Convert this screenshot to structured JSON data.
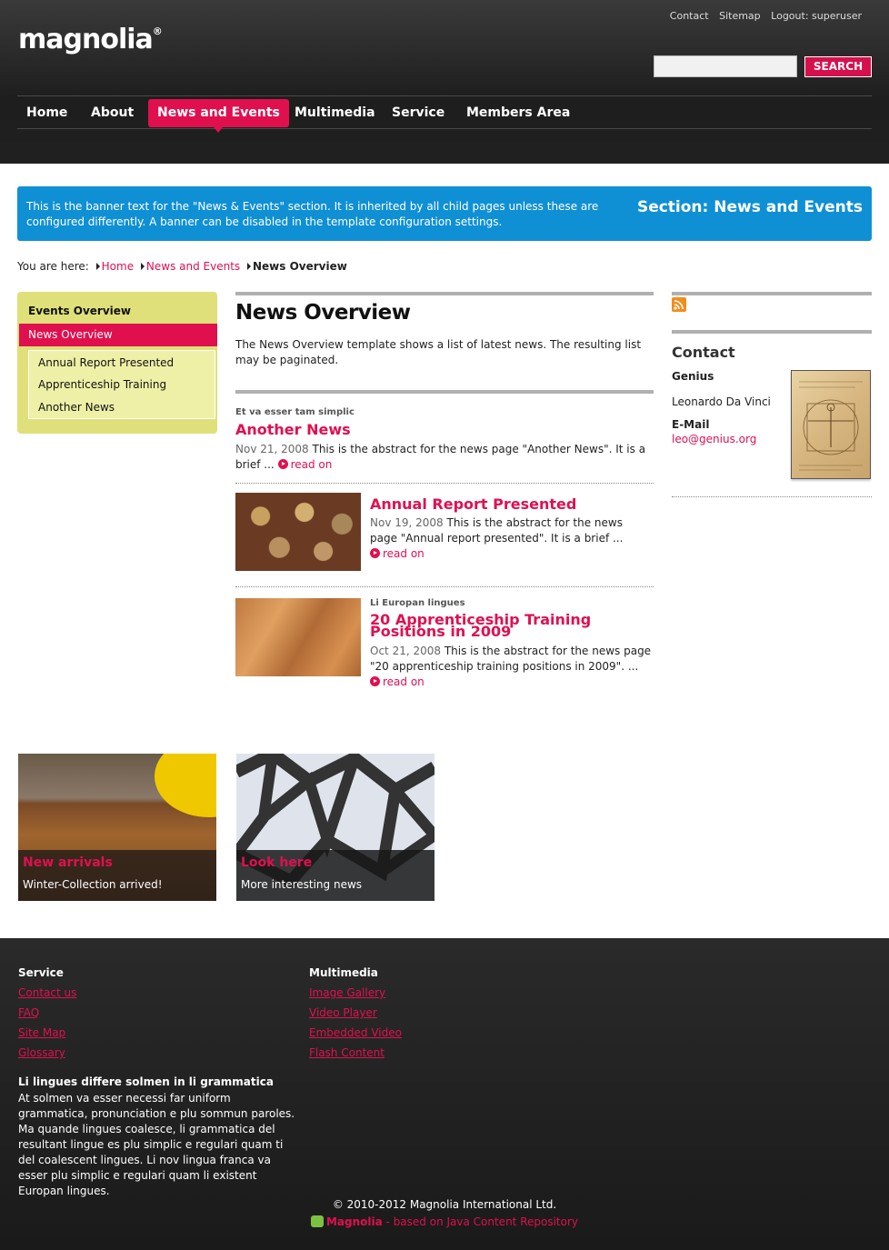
{
  "header": {
    "logo": "magnolia",
    "logo_mark": "®",
    "topnav": [
      "Contact",
      "Sitemap",
      "Logout: superuser"
    ],
    "search_placeholder": "",
    "search_label": "SEARCH",
    "nav": [
      "Home",
      "About",
      "News and Events",
      "Multimedia",
      "Service",
      "Members Area"
    ],
    "active_nav": "News and Events"
  },
  "banner": {
    "text": "This is the banner text for the \"News & Events\" section. It is inherited by all child pages unless these are configured differently. A banner can be disabled in the template configuration settings.",
    "title": "Section: News and Events",
    "color": "#1090d4"
  },
  "breadcrumb": {
    "label": "You are here:",
    "items": [
      "Home",
      "News and Events",
      "News Overview"
    ]
  },
  "subnav": {
    "parent": "Events Overview",
    "active": "News Overview",
    "children": [
      "Annual Report Presented",
      "Apprenticeship Training",
      "Another News"
    ]
  },
  "main": {
    "title": "News Overview",
    "intro": "The News Overview template shows a list of latest news. The resulting list may be paginated.",
    "news": [
      {
        "kicker": "Et va esser tam simplic",
        "title": "Another News",
        "date": "Nov 21, 2008",
        "abstract": "This is the abstract for the news page \"Another News\". It is a brief ...",
        "readon": "read on"
      },
      {
        "kicker": "",
        "title": "Annual Report Presented",
        "date": "Nov 19, 2008",
        "abstract": "This is the abstract for the news page \"Annual report presented\". It is a brief ...",
        "readon": "read on"
      },
      {
        "kicker": "Li Europan lingues",
        "title": "20 Apprenticeship Training Positions in 2009",
        "date": "Oct 21, 2008",
        "abstract": "This is the abstract for the news page \"20 apprenticeship training positions in 2009\". ...",
        "readon": "read on"
      }
    ]
  },
  "contact": {
    "title": "Contact",
    "name": "Genius",
    "person": "Leonardo  Da Vinci",
    "email_label": "E-Mail",
    "email": "leo@genius.org"
  },
  "teasers": [
    {
      "title": "New arrivals",
      "text": "Winter-Collection arrived!"
    },
    {
      "title": "Look here",
      "text": "More interesting news"
    }
  ],
  "footer": {
    "col1_title": "Service",
    "col1_links": [
      "Contact us",
      "FAQ",
      "Site Map",
      "Glossary"
    ],
    "col2_title": "Multimedia",
    "col2_links": [
      "Image Gallery",
      "Video Player",
      "Embedded Video",
      "Flash Content"
    ],
    "para_title": "Li lingues differe solmen in li grammatica",
    "para": "At solmen va esser necessi far uniform grammatica, pronunciation e plu sommun paroles. Ma quande lingues coalesce, li grammatica del resultant lingue es plu simplic e regulari quam ti del coalescent lingues. Li nov lingua franca va esser plu simplic e regulari quam li existent Europan lingues.",
    "copyright": "© 2010-2012 Magnolia International Ltd.",
    "powered_brand": "Magnolia",
    "powered_text": " - based on Java Content Repository"
  },
  "colors": {
    "accent": "#e0104f",
    "subnav_bg": "#dfe07a"
  }
}
